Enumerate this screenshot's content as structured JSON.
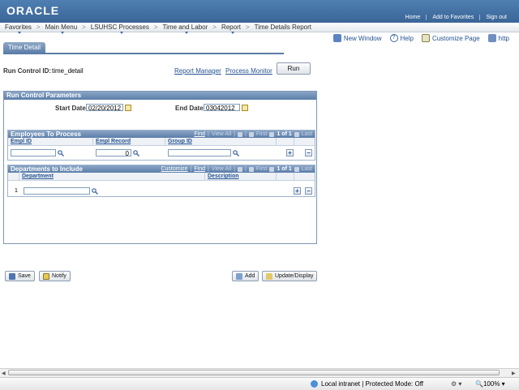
{
  "header": {
    "logo": "ORACLE",
    "links": [
      "Home",
      "Add to Favorites",
      "Sign out"
    ]
  },
  "menubar": {
    "items": [
      "Favorites",
      "Main Menu",
      "LSUHSC Processes",
      "Time and Labor",
      "Report",
      "Time Details Report"
    ],
    "separator": ">"
  },
  "pagebar": {
    "new_window": "New Window",
    "help": "Help",
    "customize_page": "Customize Page",
    "http": "http"
  },
  "page": {
    "tab_title": "Time Detail",
    "run_control_label": "Run Control ID:",
    "run_control_value": "time_detail",
    "report_manager": "Report Manager",
    "process_monitor": "Process Monitor",
    "run_button": "Run"
  },
  "params": {
    "title": "Run Control Parameters",
    "start_date_label": "Start Date:",
    "start_date_value": "02/20/2012",
    "end_date_label": "End Date:",
    "end_date_value": "03042012"
  },
  "employees_grid": {
    "title": "Employees To Process",
    "nav": {
      "find": "Find",
      "view_all": "View All",
      "first": "First",
      "count": "1 of 1",
      "last": "Last"
    },
    "columns": [
      "Empl ID",
      "Empl Record",
      "Group ID"
    ],
    "row": {
      "empl_id": "",
      "empl_record": "0",
      "group_id": ""
    }
  },
  "departments_grid": {
    "title": "Departments to Include",
    "nav": {
      "customize": "Customize",
      "find": "Find",
      "view_all": "View All",
      "first": "First",
      "count": "1 of 1",
      "last": "Last"
    },
    "columns": [
      "Department",
      "Description"
    ],
    "row": {
      "index": "1",
      "department": "",
      "description": ""
    }
  },
  "buttons": {
    "save": "Save",
    "notify": "Notify",
    "add": "Add",
    "update_display": "Update/Display"
  },
  "statusbar": {
    "zone": "Local intranet | Protected Mode: Off",
    "zoom": "100%"
  },
  "colors": {
    "header_blue": "#3a6597",
    "link_blue": "#24518f",
    "group_header": "#5c7ea9"
  }
}
